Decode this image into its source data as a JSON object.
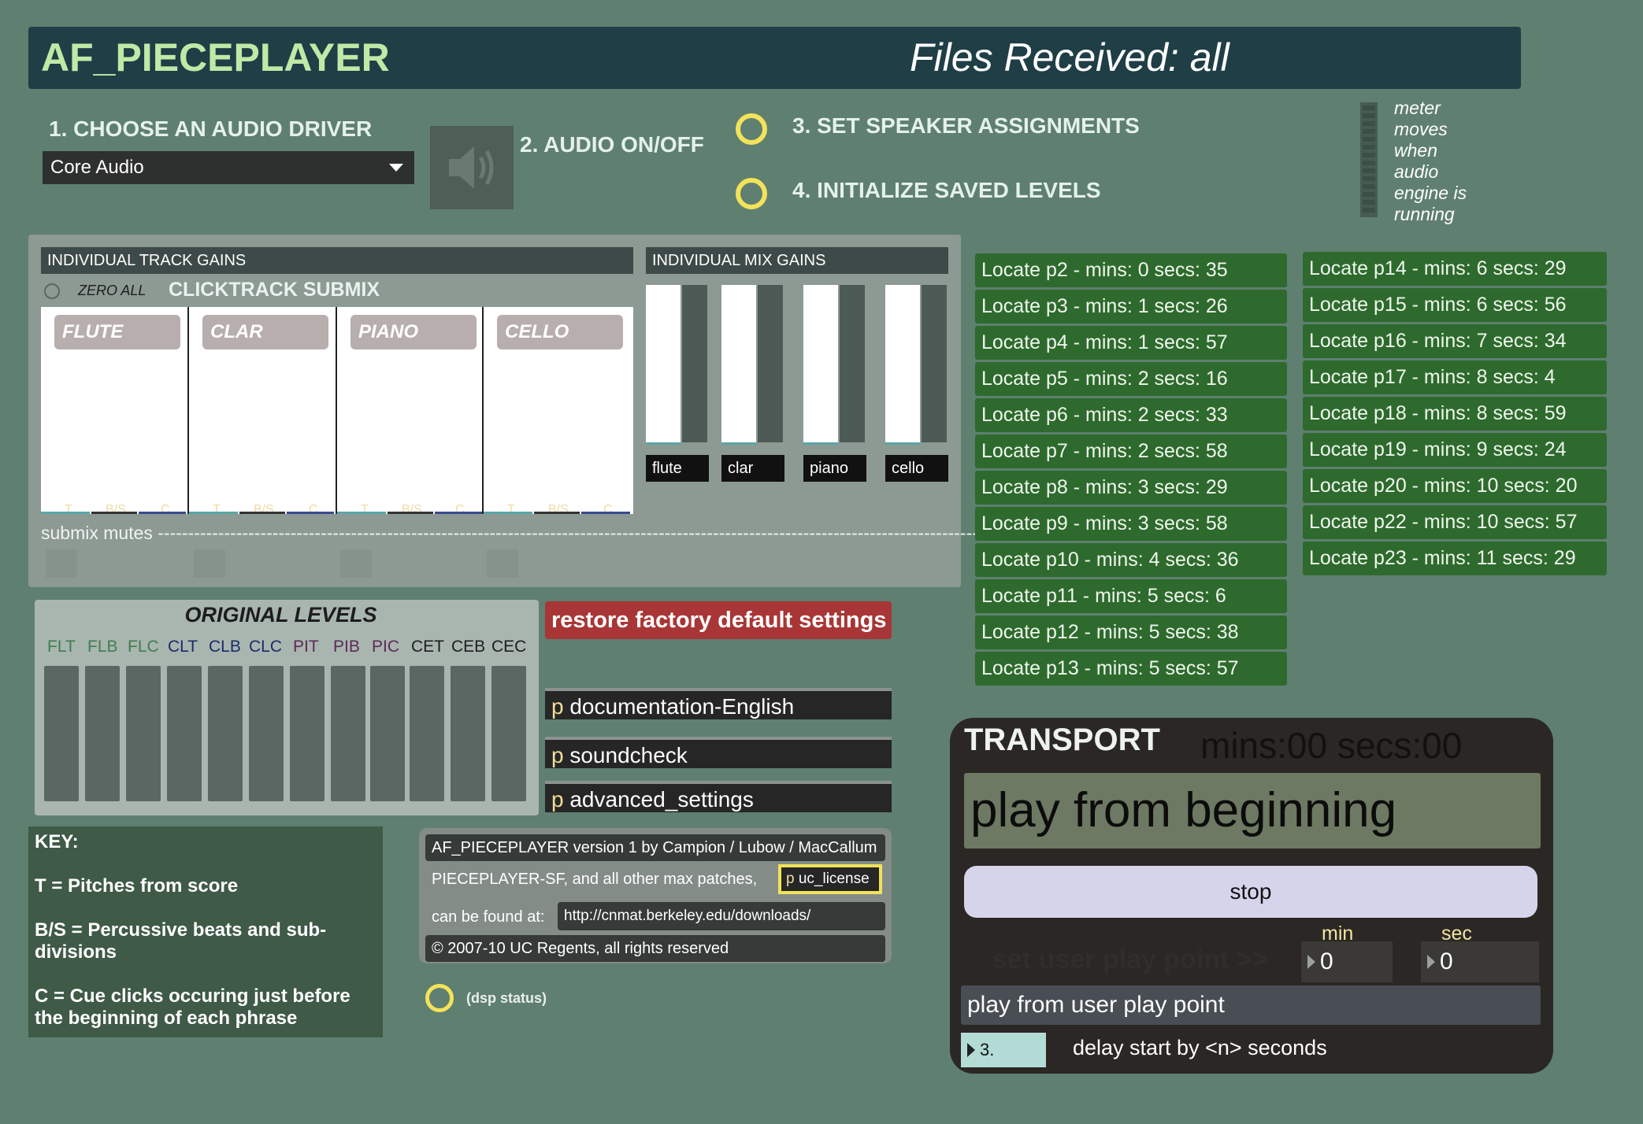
{
  "header": {
    "app_title": "AF_PIECEPLAYER",
    "files_status": "Files Received: all"
  },
  "steps": {
    "choose_driver": "1. CHOOSE AN AUDIO DRIVER",
    "audio_onoff": "2. AUDIO ON/OFF",
    "speaker_assign": "3. SET SPEAKER ASSIGNMENTS",
    "init_levels": "4. INITIALIZE SAVED LEVELS"
  },
  "driver": {
    "selected": "Core Audio"
  },
  "meter_note": [
    "meter",
    "moves",
    "when",
    "audio",
    "engine is",
    "running"
  ],
  "track_gains": {
    "header": "INDIVIDUAL TRACK GAINS",
    "zero_all": "ZERO ALL",
    "submix_title": "CLICKTRACK SUBMIX",
    "tracks": [
      {
        "name": "FLUTE",
        "labels": [
          "T",
          "B/S",
          "C"
        ]
      },
      {
        "name": "CLAR",
        "labels": [
          "T",
          "B/S",
          "C"
        ]
      },
      {
        "name": "PIANO",
        "labels": [
          "T",
          "B/S",
          "C"
        ]
      },
      {
        "name": "CELLO",
        "labels": [
          "T",
          "B/S",
          "C"
        ]
      }
    ],
    "submix_mutes": "submix  mutes -----------------------------------------------------------------------------------------------------------------------------------------------"
  },
  "mix_gains": {
    "header": "INDIVIDUAL MIX GAINS",
    "labels": [
      "flute",
      "clar",
      "piano",
      "cello"
    ]
  },
  "locates": [
    "Locate p2 - mins: 0 secs: 35",
    "Locate p3 - mins: 1 secs: 26",
    "Locate p4 - mins: 1 secs: 57",
    "Locate p5 - mins: 2 secs: 16",
    "Locate p6 - mins: 2 secs: 33",
    "Locate p7 - mins: 2 secs: 58",
    "Locate p8 - mins: 3 secs: 29",
    "Locate p9 - mins: 3 secs: 58",
    "Locate p10 - mins: 4 secs: 36",
    "Locate p11 - mins: 5 secs: 6",
    "Locate p12 - mins: 5 secs: 38",
    "Locate p13 - mins: 5 secs: 57",
    "Locate p14 - mins: 6 secs: 29",
    "Locate p15 - mins: 6 secs: 56",
    "Locate p16 - mins: 7 secs: 34",
    "Locate p17 - mins: 8 secs: 4",
    "Locate p18 - mins: 8 secs: 59",
    "Locate p19 - mins: 9 secs: 24",
    "Locate p20 - mins: 10 secs: 20",
    "Locate p22 - mins: 10 secs: 57",
    "Locate p23 - mins: 11 secs: 29"
  ],
  "original_levels": {
    "title": "ORIGINAL LEVELS",
    "labels": [
      "FLT",
      "FLB",
      "FLC",
      "CLT",
      "CLB",
      "CLC",
      "PIT",
      "PIB",
      "PIC",
      "CET",
      "CEB",
      "CEC"
    ]
  },
  "restore_label": "restore factory default settings",
  "patchers": [
    {
      "p": "p",
      "name": "documentation-English"
    },
    {
      "p": "p",
      "name": "soundcheck"
    },
    {
      "p": "p",
      "name": "advanced_settings"
    }
  ],
  "key": {
    "title": "KEY:",
    "t": "T = Pitches from score",
    "bs": "B/S = Percussive beats and sub-divisions",
    "c": "C = Cue clicks occuring just before the beginning of each phrase"
  },
  "about": {
    "version": "AF_PIECEPLAYER version 1 by Campion / Lubow / MacCallum",
    "patches_line": "PIECEPLAYER-SF, and all other max patches,",
    "license_p": "p",
    "license_name": "uc_license",
    "found_at": "can be found at:",
    "url": "http://cnmat.berkeley.edu/downloads/",
    "copyright": "© 2007-10 UC Regents, all rights reserved"
  },
  "dsp_status": "(dsp status)",
  "transport": {
    "title": "TRANSPORT",
    "time": "mins:00 secs:00",
    "play_from_beginning": "play from beginning",
    "stop": "stop",
    "min_label": "min",
    "sec_label": "sec",
    "set_user_point": "set user play point >>",
    "min_value": "0",
    "sec_value": "0",
    "play_from_user": "play from user play point",
    "delay_value": "3.",
    "delay_label": "delay start by <n> seconds"
  }
}
